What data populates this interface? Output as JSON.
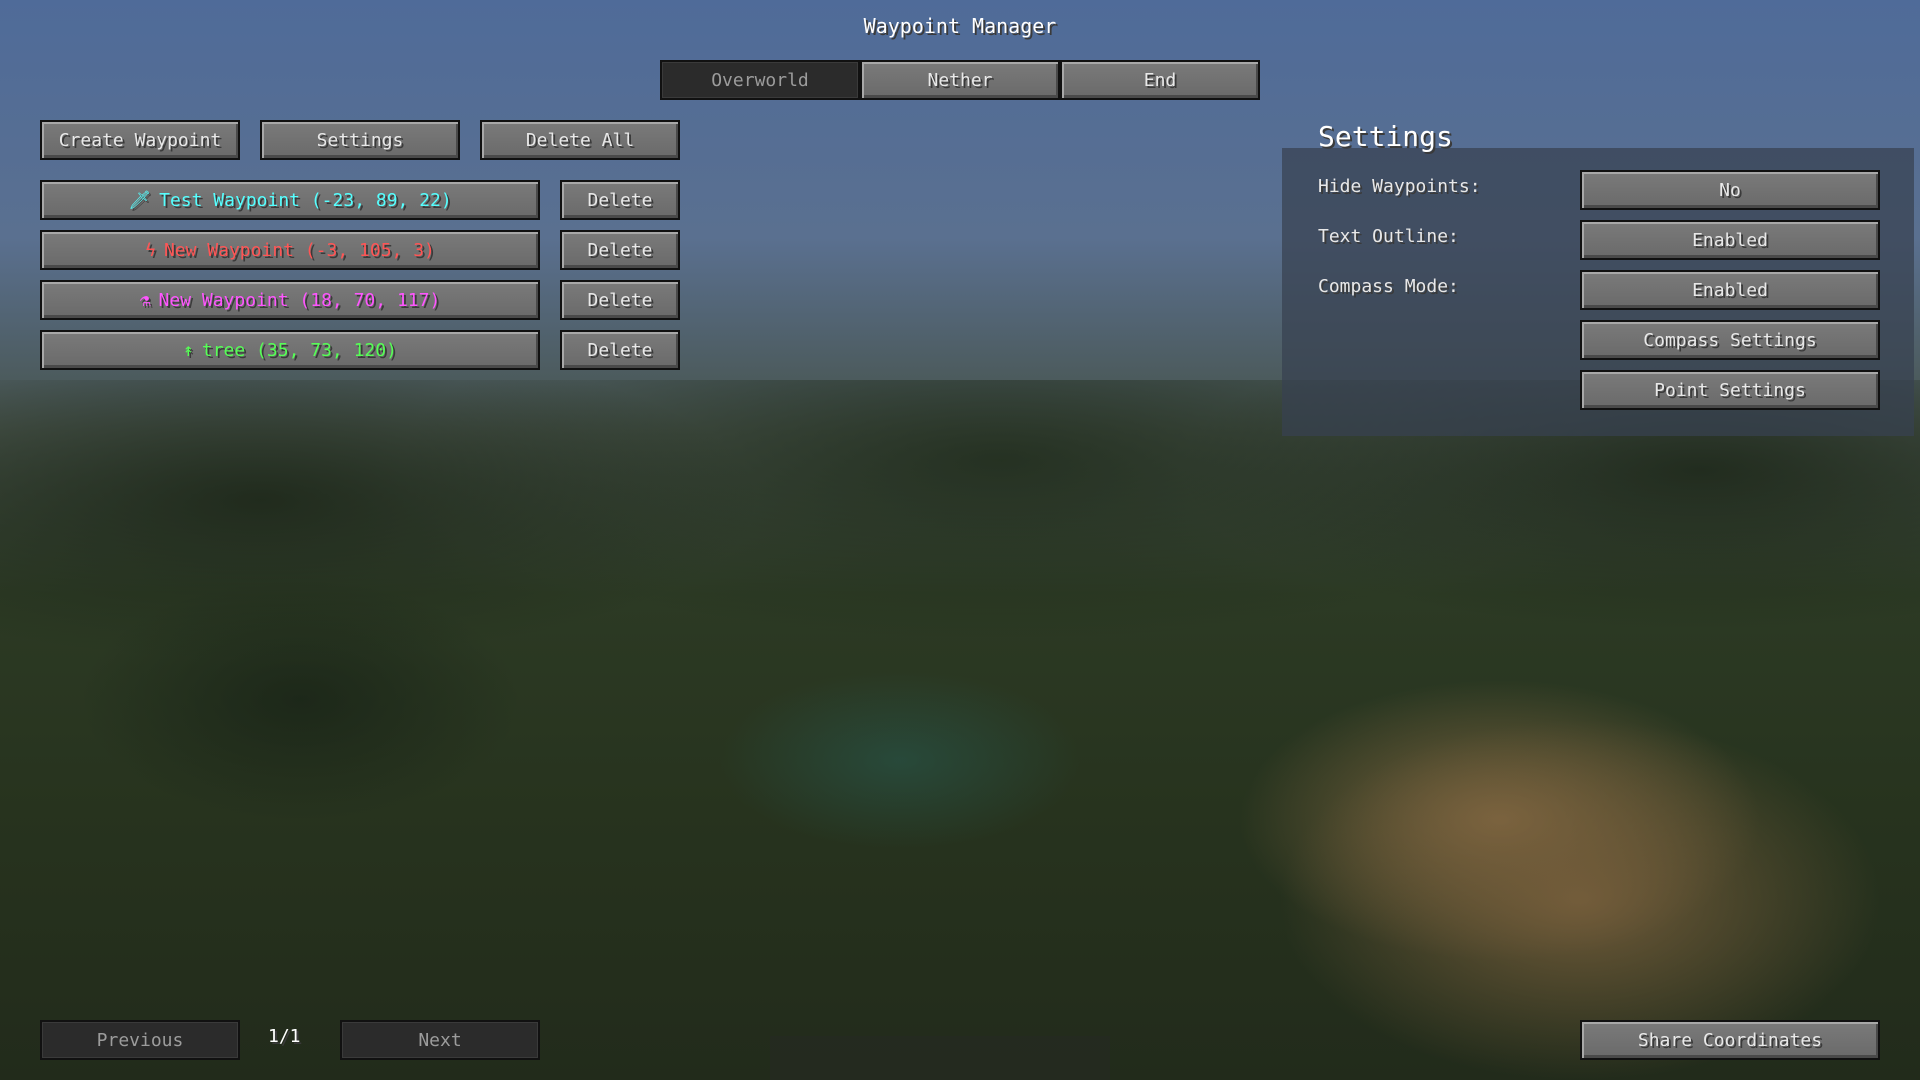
{
  "title": "Waypoint Manager",
  "dimension_tabs": [
    {
      "label": "Overworld",
      "selected": true
    },
    {
      "label": "Nether",
      "selected": false
    },
    {
      "label": "End",
      "selected": false
    }
  ],
  "toolbar": {
    "create_label": "Create Waypoint",
    "settings_label": "Settings",
    "delete_all_label": "Delete All"
  },
  "waypoints": [
    {
      "icon": "sword-icon",
      "glyph": "🗡",
      "label": "Test Waypoint (-23, 89, 22)",
      "color": "#55ffff",
      "delete_label": "Delete"
    },
    {
      "icon": "lightning-icon",
      "glyph": "ϟ",
      "label": "New Waypoint (-3, 105, 3)",
      "color": "#ff5555",
      "delete_label": "Delete"
    },
    {
      "icon": "potion-icon",
      "glyph": "⚗",
      "label": "New Waypoint (18, 70, 117)",
      "color": "#ff55ff",
      "delete_label": "Delete"
    },
    {
      "icon": "sapling-icon",
      "glyph": "↟",
      "label": "tree (35, 73, 120)",
      "color": "#55ff55",
      "delete_label": "Delete"
    }
  ],
  "settings": {
    "title": "Settings",
    "rows": [
      {
        "label": "Hide Waypoints:",
        "value": "No"
      },
      {
        "label": "Text Outline:",
        "value": "Enabled"
      },
      {
        "label": "Compass Mode:",
        "value": "Enabled"
      }
    ],
    "compass_settings_label": "Compass Settings",
    "point_settings_label": "Point Settings"
  },
  "pagination": {
    "previous_label": "Previous",
    "page": "1/1",
    "next_label": "Next"
  },
  "share_label": "Share Coordinates"
}
